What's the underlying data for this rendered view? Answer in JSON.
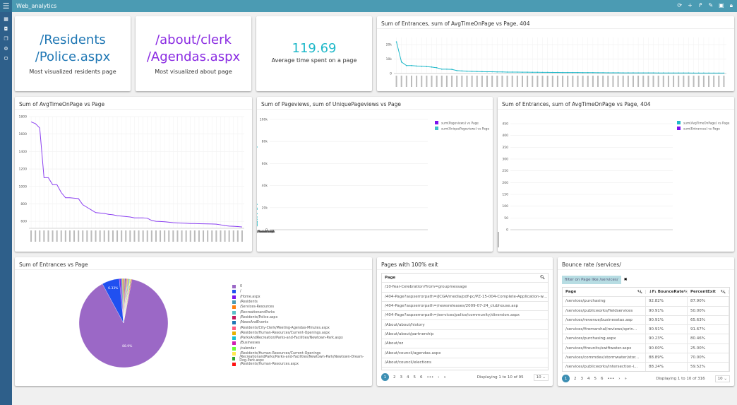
{
  "app": {
    "title": "Web_analytics",
    "top_icons": [
      "refresh-icon",
      "plus-icon",
      "share-icon",
      "edit-icon",
      "save-icon",
      "lock-icon"
    ],
    "side_icons": [
      "grid-icon",
      "dashboard-icon",
      "copy-icon",
      "settings-icon",
      "power-icon"
    ]
  },
  "big1": {
    "value": "/Residents\n/Police.aspx",
    "line1": "/Residents",
    "line2": "/Police.aspx",
    "label": "Most visualized residents page",
    "color": "#1f77b4"
  },
  "big2": {
    "line1": "/about/clerk",
    "line2": "/Agendas.aspx",
    "label": "Most visualized about page",
    "color": "#8a2be2"
  },
  "big3": {
    "value": "119.69",
    "label": "Average time spent on a page",
    "color": "#1fb8c9"
  },
  "chart_data": [
    {
      "id": "top404",
      "type": "line",
      "title": "Sum of Entrances, sum of AvgTimeOnPage vs Page, 404",
      "ylim": [
        0,
        25000
      ],
      "yticks": [
        "0",
        "10k",
        "20k"
      ],
      "ytick_values": [
        0,
        10000,
        20000
      ],
      "color": "#1fb8c9",
      "values": [
        22000,
        8000,
        5500,
        5500,
        5200,
        5000,
        4800,
        4500,
        4000,
        3000,
        3000,
        2900,
        2000,
        1800,
        1600,
        1500,
        1400,
        1300,
        1200,
        1200,
        1100,
        1100,
        1000,
        1000,
        950,
        900,
        900,
        850,
        850,
        800,
        800,
        750,
        750,
        700,
        700,
        650,
        650,
        600,
        600,
        600,
        550,
        550,
        500,
        500,
        500,
        450,
        450,
        450,
        400,
        400,
        400,
        400,
        380,
        380,
        360,
        360,
        350,
        350,
        340,
        330,
        320,
        320,
        310,
        300,
        300,
        300
      ]
    },
    {
      "id": "avgtime",
      "type": "line",
      "title": "Sum of AvgTimeOnPage vs Page",
      "ylim": [
        520,
        1800
      ],
      "yticks": [
        "600",
        "800",
        "1000",
        "1200",
        "1400",
        "1600",
        "1800"
      ],
      "ytick_values": [
        600,
        800,
        1000,
        1200,
        1400,
        1600,
        1800
      ],
      "color": "#8a3ff0",
      "values": [
        1740,
        1720,
        1670,
        1100,
        1100,
        1020,
        1020,
        930,
        870,
        870,
        865,
        860,
        790,
        760,
        730,
        700,
        695,
        690,
        680,
        675,
        665,
        660,
        655,
        650,
        640,
        640,
        640,
        635,
        610,
        600,
        598,
        595,
        590,
        585,
        582,
        580,
        578,
        575,
        575,
        573,
        572,
        571,
        570,
        568,
        560,
        550,
        545,
        543,
        540,
        535
      ]
    },
    {
      "id": "pageviews",
      "type": "bar+line",
      "title": "Sum of Pageviews, sum of UniquePageviews vs Page",
      "ylim": [
        0,
        100000
      ],
      "yticks": [
        "0",
        "20k",
        "40k",
        "60k",
        "80k",
        "100k"
      ],
      "ytick_values": [
        0,
        20000,
        40000,
        60000,
        80000,
        100000
      ],
      "categories": [
        "/",
        "/Home.aspx",
        "/Residents",
        "/Services-R",
        "/Recreation",
        "/Recreatio",
        "/NewsAndE",
        "/Residents/",
        "/Businesses",
        "/ParksAndR",
        "/calendar",
        "/Residents/",
        "/Residents/",
        "/Residents/",
        "/Services-R",
        "/Residents/",
        "/Residents-",
        "/Residents/",
        "/ParksAndR",
        "/ParksAndR"
      ],
      "series": [
        {
          "name": "sum(Pageviews) vs Page",
          "color": "#7b12ee",
          "values": [
            96000,
            29000,
            28000,
            24500,
            22500,
            22000,
            15500,
            12000,
            10500,
            10500,
            8700,
            8500,
            8300,
            8000,
            8000,
            6500,
            6500,
            6300,
            6300,
            6000
          ]
        },
        {
          "name": "sum(UniquePageviews) vs Page",
          "color": "#3fc1c9",
          "values": [
            75000,
            23000,
            19500,
            18500,
            14500,
            14500,
            11500,
            9500,
            7500,
            7500,
            7500,
            7500,
            6500,
            7000,
            7000,
            5000,
            4500,
            4000,
            5500,
            3500
          ]
        }
      ],
      "legend": "top-right"
    },
    {
      "id": "entr404",
      "type": "stacked-bar",
      "title": "Sum of Entrances, sum of AvgTimeOnPage vs Page, 404",
      "ylim": [
        0,
        480
      ],
      "yticks": [
        "0",
        "50",
        "100",
        "150",
        "200",
        "250",
        "300",
        "350",
        "400",
        "450"
      ],
      "ytick_values": [
        0,
        50,
        100,
        150,
        200,
        250,
        300,
        350,
        400,
        450
      ],
      "series": [
        {
          "name": "sum(AvgTimeOnPage) vs Page",
          "color": "#1fb8c9",
          "values": [
            5,
            4,
            5,
            3,
            6,
            6,
            6,
            7,
            7,
            10,
            9,
            10,
            14,
            17,
            17,
            19,
            17,
            19,
            33,
            23,
            24,
            25,
            25,
            49,
            38,
            44,
            50,
            48,
            57,
            60,
            62,
            69,
            78,
            83,
            83,
            108,
            144,
            189,
            202,
            340,
            462
          ]
        },
        {
          "name": "sum(Entrances) vs Page",
          "color": "#7b12ee",
          "values": [
            5,
            4,
            5,
            2,
            1,
            1,
            1,
            1,
            1,
            1,
            1,
            1,
            1,
            3,
            1,
            3,
            1,
            1,
            10,
            1,
            1,
            2,
            1,
            15,
            2,
            2,
            7,
            3,
            1,
            1,
            1,
            1,
            2,
            3,
            1,
            1,
            1,
            1,
            3,
            1,
            1
          ]
        }
      ],
      "legend": "top-right"
    },
    {
      "id": "pie",
      "type": "pie",
      "title": "Sum of Entrances vs Page",
      "labels_shown": [
        "88.9%",
        "6.33%"
      ],
      "slices": [
        {
          "label": "0",
          "value": 88.9,
          "color": "#9b68c6"
        },
        {
          "label": "/",
          "value": 6.33,
          "color": "#2050f0"
        },
        {
          "label": "/Home.aspx",
          "value": 0.6,
          "color": "#7b12ee"
        },
        {
          "label": "/Residents",
          "value": 0.5,
          "color": "#4a9bb3"
        },
        {
          "label": "/Services-Resources",
          "value": 0.45,
          "color": "#ff7f0e"
        },
        {
          "label": "/RecreationandParks",
          "value": 0.4,
          "color": "#5bc0c9"
        },
        {
          "label": "/Residents/Police.aspx",
          "value": 0.35,
          "color": "#c2185b"
        },
        {
          "label": "/NewsAndEvents",
          "value": 0.3,
          "color": "#1f77b4"
        },
        {
          "label": "/Residents/City-Clerk/Meeting-Agendas-Minutes.aspx",
          "value": 0.28,
          "color": "#ff5b7f"
        },
        {
          "label": "/Residents/Human-Resources/Current-Openings.aspx",
          "value": 0.27,
          "color": "#e6b000"
        },
        {
          "label": "/ParksAndRecreation/Parks-and-Facilities/Newtown-Park.aspx",
          "value": 0.26,
          "color": "#17becf"
        },
        {
          "label": "/Businesses",
          "value": 0.25,
          "color": "#d01fb0"
        },
        {
          "label": "/calendar",
          "value": 0.24,
          "color": "#66ff33"
        },
        {
          "label": "/Residents/Human-Resources/Current-Openings",
          "value": 0.23,
          "color": "#ffe84d"
        },
        {
          "label": "/RecreationandParks/Parks-and-Facilities/Newtown-Park/Newtown-Dream-Dog-Park.aspx",
          "value": 0.22,
          "color": "#2ca02c"
        },
        {
          "label": "/Residents/Human-Resources.aspx",
          "value": 0.2,
          "color": "#ff1010"
        }
      ],
      "legend": "right"
    }
  ],
  "exit_table": {
    "title": "Pages with 100% exit",
    "header": "Page",
    "rows": [
      "/10-Year-Celebration?from=groupmessage",
      "/404-Page?aspxerrorpath=/JCGA/media/pdf-pc/PZ-15-004-Complete-Application-web.pdf?ext=...",
      "/404-Page?aspxerrorpath=/newsreleases/2009-07-24_clubhouse.asp",
      "/404-Page?aspxerrorpath=/services/police/community/diversion.aspx",
      "/About/about/history",
      "/About/about/partnership",
      "/About/oz",
      "/About/council/agendas.aspx",
      "/About/council/elections"
    ],
    "pages": [
      "1",
      "2",
      "3",
      "4",
      "5",
      "6",
      "•••",
      "›",
      "»"
    ],
    "info": "Displaying 1 to 10 of 95",
    "page_size": "10"
  },
  "bounce_table": {
    "title": "Bounce rate /services/",
    "filter": "filter on Page like /services/",
    "headers": [
      "Page",
      "BounceRate",
      "PercentExit"
    ],
    "rows": [
      [
        "/services/purchasing",
        "92.82%",
        "87.90%"
      ],
      [
        "/services/publicworks/fieldservices",
        "90.91%",
        "50.00%"
      ],
      [
        "/services/revenue/businesstax.asp",
        "90.91%",
        "65.63%"
      ],
      [
        "/services/firemarshal/reviews/sprin...",
        "90.91%",
        "91.67%"
      ],
      [
        "/services/purchasing.aspx",
        "90.23%",
        "80.46%"
      ],
      [
        "/services/fireunits/swiftwater.aspx",
        "90.00%",
        "25.00%"
      ],
      [
        "/services/commdev/stormwater/stor...",
        "88.89%",
        "70.00%"
      ],
      [
        "/services/publicworks/intersection-i...",
        "88.24%",
        "59.52%"
      ]
    ],
    "pages": [
      "1",
      "2",
      "3",
      "4",
      "5",
      "6",
      "•••",
      "›",
      "»"
    ],
    "info": "Displaying 1 to 10 of 316",
    "page_size": "10"
  }
}
